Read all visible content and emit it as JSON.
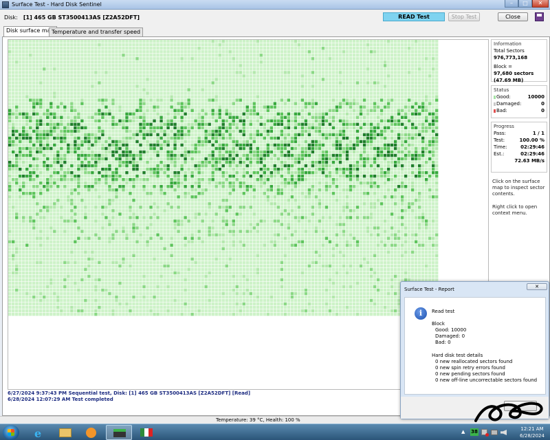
{
  "window": {
    "title": "Surface Test - Hard Disk Sentinel",
    "controls": {
      "minimize": "–",
      "maximize": "□",
      "close": "✕"
    }
  },
  "toolbar": {
    "disk_label": "Disk:",
    "disk_value": "[1] 465 GB  ST3500413AS [Z2A52DFT]",
    "status": "READ Test",
    "stop_label": "Stop Test",
    "close_label": "Close"
  },
  "tabs": [
    {
      "label": "Disk surface map",
      "active": true
    },
    {
      "label": "Temperature and transfer speed",
      "active": false
    }
  ],
  "info": {
    "group_title": "Information",
    "total_sectors_label": "Total Sectors",
    "total_sectors": "976,773,168",
    "block_label": "Block =",
    "block_sectors": "97,680 sectors",
    "block_size": "(47.69 MB)"
  },
  "status": {
    "group_title": "Status",
    "good_label": "Good:",
    "good": "10000",
    "damaged_label": "Damaged:",
    "damaged": "0",
    "bad_label": "Bad:",
    "bad": "0",
    "colors": {
      "good": "#a6e3a6",
      "damaged": "#c8c8c8",
      "bad": "#e05050"
    }
  },
  "progress": {
    "group_title": "Progress",
    "pass_label": "Pass:",
    "pass": "1 / 1",
    "test_label": "Test:",
    "test": "100.00 %",
    "time_label": "Time:",
    "time": "02:29:46",
    "est_label": "Est.:",
    "est": "02:29:46",
    "speed": "72.63 MB/s"
  },
  "help": {
    "click": "Click on the surface map to inspect sector contents.",
    "right_click": "Right click to open context menu."
  },
  "log": [
    "6/27/2024  9:37:43 PM  Sequential test, Disk: [1] 465 GB  ST3500413AS [Z2A52DFT] [Read]",
    "6/28/2024  12:07:29 AM  Test completed"
  ],
  "statusbar": {
    "text": "Temperature: 39  °C,  Health: 100 %"
  },
  "report": {
    "title": "Surface Test - Report",
    "close": "✕",
    "heading": "Read test",
    "block_heading": "Block",
    "good": "Good: 10000",
    "damaged": "Damaged: 0",
    "bad": "Bad: 0",
    "details_heading": "Hard disk test details",
    "details": [
      "0 new reallocated sectors found",
      "0 new spin retry errors found",
      "0 new pending sectors found",
      "0 new off-line uncorrectable sectors found"
    ]
  },
  "map": {
    "cols": 125,
    "rows": 80,
    "filled_rows": 80,
    "palette": [
      "#cdf2c8",
      "#b3e8ac",
      "#8ad884",
      "#5cc45a",
      "#36a83c",
      "#1f7f2a"
    ],
    "grid_color": "#9fd99a"
  },
  "tray": {
    "badge": "38",
    "time": "12:21 AM",
    "date": "6/28/2024"
  },
  "icons": {
    "app": "hard-disk-sentinel-icon",
    "save": "save-icon",
    "info": "info-icon",
    "start": "windows-start-icon"
  }
}
